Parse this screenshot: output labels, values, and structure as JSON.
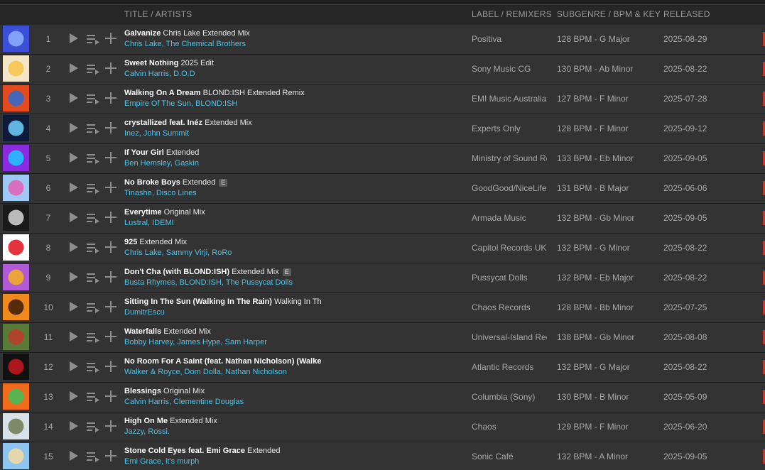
{
  "header": {
    "title_artists": "TITLE / ARTISTS",
    "label_remixers": "LABEL / REMIXERS",
    "subgenre": "SUBGENRE / BPM & KEY",
    "released": "RELEASED"
  },
  "tracks": [
    {
      "num": "1",
      "name": "Galvanize",
      "mix": "Chris Lake Extended Mix",
      "artists": "Chris Lake, The Chemical Brothers",
      "label": "Positiva",
      "bpm": "128 BPM - G Major",
      "released": "2025-08-29",
      "explicit": "",
      "art": [
        "#3b4fd8",
        "#8fb0ff"
      ]
    },
    {
      "num": "2",
      "name": "Sweet Nothing",
      "mix": "2025 Edit",
      "artists": "Calvin Harris, D.O.D",
      "label": "Sony Music CG",
      "bpm": "130 BPM - Ab Minor",
      "released": "2025-08-22",
      "explicit": "",
      "art": [
        "#f3e6c9",
        "#f7c34a"
      ]
    },
    {
      "num": "3",
      "name": "Walking On A Dream",
      "mix": "BLOND:ISH Extended Remix",
      "artists": "Empire Of The Sun, BLOND:ISH",
      "label": "EMI Music Australia",
      "bpm": "127 BPM - F Minor",
      "released": "2025-07-28",
      "explicit": "",
      "art": [
        "#e34b1f",
        "#2a6bd1"
      ]
    },
    {
      "num": "4",
      "name": "crystallized feat. Inéz",
      "mix": "Extended Mix",
      "artists": "Inez, John Summit",
      "label": "Experts Only",
      "bpm": "128 BPM - F Minor",
      "released": "2025-09-12",
      "explicit": "",
      "art": [
        "#0d1a3a",
        "#6fd3ff"
      ]
    },
    {
      "num": "5",
      "name": "If Your Girl",
      "mix": "Extended",
      "artists": "Ben Hemsley, Gaskin",
      "label": "Ministry of Sound Re",
      "bpm": "133 BPM - Eb Minor",
      "released": "2025-09-05",
      "explicit": "",
      "art": [
        "#8a2be2",
        "#1ec8ff"
      ]
    },
    {
      "num": "6",
      "name": "No Broke Boys",
      "mix": "Extended",
      "artists": "Tinashe, Disco Lines",
      "label": "GoodGood/NiceLife",
      "bpm": "131 BPM - B Major",
      "released": "2025-06-06",
      "explicit": "E",
      "art": [
        "#9ec9f5",
        "#e25fb4"
      ]
    },
    {
      "num": "7",
      "name": "Everytime",
      "mix": "Original Mix",
      "artists": "Lustral, IDEMI",
      "label": "Armada Music",
      "bpm": "132 BPM - Gb Minor",
      "released": "2025-09-05",
      "explicit": "",
      "art": [
        "#1a1a1a",
        "#d8d8d8"
      ]
    },
    {
      "num": "8",
      "name": "925",
      "mix": "Extended Mix",
      "artists": "Chris Lake, Sammy Virji, RoRo",
      "label": "Capitol Records UK",
      "bpm": "132 BPM - G Minor",
      "released": "2025-08-22",
      "explicit": "",
      "art": [
        "#ffffff",
        "#e0111b"
      ]
    },
    {
      "num": "9",
      "name": "Don't Cha (with BLOND:ISH)",
      "mix": "Extended Mix",
      "artists": "Busta Rhymes, BLOND:ISH, The Pussycat Dolls",
      "label": "Pussycat Dolls",
      "bpm": "132 BPM - Eb Major",
      "released": "2025-08-22",
      "explicit": "E",
      "art": [
        "#b05ad8",
        "#f6b21e"
      ]
    },
    {
      "num": "10",
      "name": "Sitting In The Sun (Walking In The Rain)",
      "mix": "Walking In Th",
      "artists": "DumitrEscu",
      "label": "Chaos Records",
      "bpm": "128 BPM - Bb Minor",
      "released": "2025-07-25",
      "explicit": "",
      "art": [
        "#f08a1c",
        "#3a1a08"
      ]
    },
    {
      "num": "11",
      "name": "Waterfalls",
      "mix": "Extended Mix",
      "artists": "Bobby Harvey, James Hype, Sam Harper",
      "label": "Universal-Island Rec",
      "bpm": "138 BPM - Gb Minor",
      "released": "2025-08-08",
      "explicit": "",
      "art": [
        "#5a7a3a",
        "#c03a2a"
      ]
    },
    {
      "num": "12",
      "name": "No Room For A Saint (feat. Nathan Nicholson) (Walke",
      "mix": "",
      "artists": "Walker & Royce, Dom Dolla, Nathan Nicholson",
      "label": "Atlantic Records",
      "bpm": "132 BPM - G Major",
      "released": "2025-08-22",
      "explicit": "",
      "art": [
        "#111111",
        "#c8181e"
      ]
    },
    {
      "num": "13",
      "name": "Blessings",
      "mix": "Original Mix",
      "artists": "Calvin Harris, Clementine Douglas",
      "label": "Columbia (Sony)",
      "bpm": "130 BPM - B Minor",
      "released": "2025-05-09",
      "explicit": "",
      "art": [
        "#f26a1b",
        "#3fbf5a"
      ]
    },
    {
      "num": "14",
      "name": "High On Me",
      "mix": "Extended Mix",
      "artists": "Jazzy, Rossi.",
      "label": "Chaos",
      "bpm": "129 BPM - F Minor",
      "released": "2025-06-20",
      "explicit": "",
      "art": [
        "#d9e2e8",
        "#6b7a52"
      ]
    },
    {
      "num": "15",
      "name": "Stone Cold Eyes feat. Emi Grace",
      "mix": "Extended",
      "artists": "Emi Grace, it's murph",
      "label": "Sonic Café",
      "bpm": "132 BPM - A Minor",
      "released": "2025-09-05",
      "explicit": "",
      "art": [
        "#8ec5ef",
        "#f3d9a0"
      ]
    }
  ],
  "icons": {
    "play": "play-icon",
    "queue": "add-to-queue-icon",
    "add": "plus-icon"
  },
  "colors": {
    "artist_link": "#4fc3e8",
    "row_bg": "#333333",
    "page_bg": "#262626"
  }
}
